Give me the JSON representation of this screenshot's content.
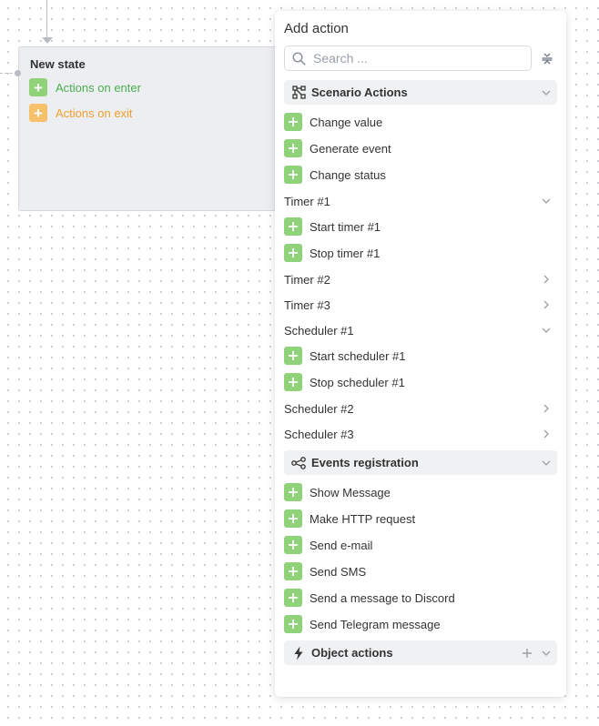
{
  "state": {
    "title": "New state",
    "actions_on_enter": "Actions on enter",
    "actions_on_exit": "Actions on exit"
  },
  "panel": {
    "title": "Add action",
    "search_placeholder": "Search ..."
  },
  "groups": {
    "scenario": {
      "label": "Scenario Actions",
      "items": [
        "Change value",
        "Generate event",
        "Change status"
      ],
      "timers": [
        {
          "label": "Timer #1",
          "expanded": true,
          "items": [
            "Start timer #1",
            "Stop timer #1"
          ]
        },
        {
          "label": "Timer #2",
          "expanded": false
        },
        {
          "label": "Timer #3",
          "expanded": false
        }
      ],
      "schedulers": [
        {
          "label": "Scheduler #1",
          "expanded": true,
          "items": [
            "Start scheduler #1",
            "Stop scheduler #1"
          ]
        },
        {
          "label": "Scheduler #2",
          "expanded": false
        },
        {
          "label": "Scheduler #3",
          "expanded": false
        }
      ]
    },
    "events": {
      "label": "Events registration",
      "items": [
        "Show Message",
        "Make HTTP request",
        "Send e-mail",
        "Send SMS",
        "Send a message to Discord",
        "Send Telegram message"
      ]
    },
    "object": {
      "label": "Object actions"
    }
  },
  "colors": {
    "green_accent": "#8fd27a",
    "green_text": "#4caf50",
    "orange_accent": "#f7c06a",
    "orange_text": "#f0a030",
    "group_bg": "#f0f1f3"
  },
  "icons": {
    "search": "search-icon",
    "collapse_all": "collapse-all-icon",
    "scenario": "scenario-graph-icon",
    "events": "share-nodes-icon",
    "object": "lightning-icon",
    "plus": "plus-icon",
    "chevron_down": "chevron-down-icon",
    "chevron_right": "chevron-right-icon"
  }
}
